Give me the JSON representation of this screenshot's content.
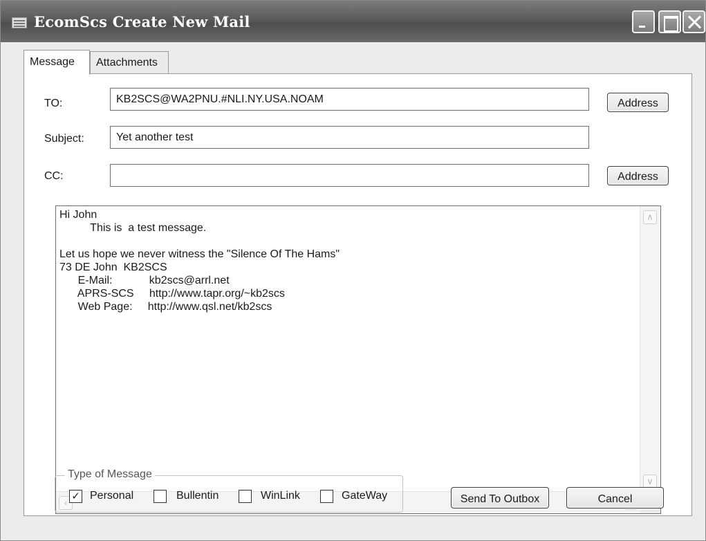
{
  "window": {
    "title": "EcomScs Create New Mail",
    "icon": "app-window-icon"
  },
  "tabs": [
    {
      "label": "Message",
      "active": true
    },
    {
      "label": "Attachments",
      "active": false
    }
  ],
  "form": {
    "to_label": "TO:",
    "to_value": "KB2SCS@WA2PNU.#NLI.NY.USA.NOAM",
    "subject_label": "Subject:",
    "subject_value": "Yet another test",
    "cc_label": "CC:",
    "cc_value": "",
    "address_button_label": "Address"
  },
  "message_body": "Hi John\n          This is  a test message.\n\nLet us hope we never witness the \"Silence Of The Hams\"\n73 DE John  KB2SCS\n      E-Mail:            kb2scs@arrl.net\n      APRS-SCS     http://www.tapr.org/~kb2scs\n      Web Page:     http://www.qsl.net/kb2scs",
  "message_type": {
    "legend": "Type of Message",
    "options": [
      {
        "label": "Personal",
        "checked": true
      },
      {
        "label": "Bullentin",
        "checked": false
      },
      {
        "label": "WinLink",
        "checked": false
      },
      {
        "label": "GateWay",
        "checked": false
      }
    ]
  },
  "actions": {
    "send_label": "Send To Outbox",
    "cancel_label": "Cancel"
  },
  "colors": {
    "titlebar": "#5a5a5a",
    "panel_background": "#ffffff"
  }
}
